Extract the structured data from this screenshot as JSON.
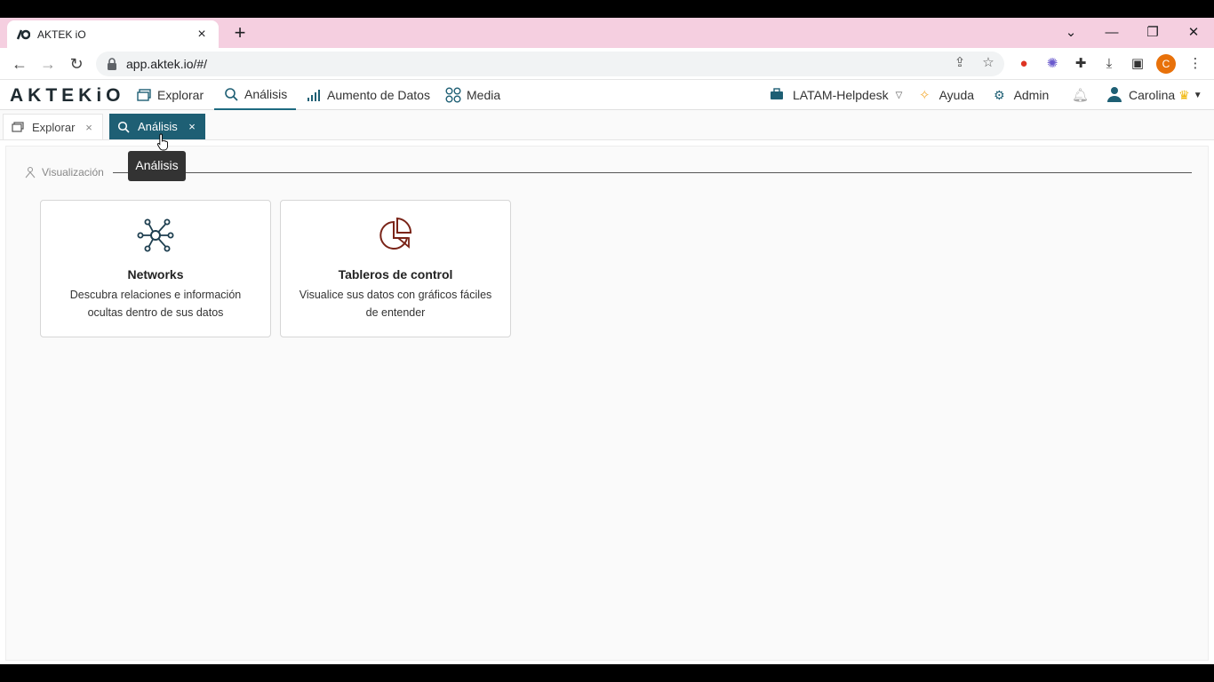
{
  "browser": {
    "tab_title": "AKTEK iO",
    "tab_close": "×",
    "new_tab": "+",
    "url": "app.aktek.io/#/",
    "profile_initial": "C",
    "window_controls": {
      "dropdown": "⌄",
      "minimize": "—",
      "restore": "❐",
      "close": "✕"
    }
  },
  "app": {
    "logo": "AKTEKiO",
    "nav": [
      {
        "label": "Explorar",
        "icon": "window-icon"
      },
      {
        "label": "Análisis",
        "icon": "search-analytics-icon",
        "active": true
      },
      {
        "label": "Aumento de Datos",
        "icon": "bar-chart-icon"
      },
      {
        "label": "Media",
        "icon": "grid-circles-icon"
      }
    ],
    "workspace": "LATAM-Helpdesk",
    "help": "Ayuda",
    "admin": "Admin",
    "user": "Carolina"
  },
  "workspace_tabs": [
    {
      "label": "Explorar",
      "close": "×"
    },
    {
      "label": "Análisis",
      "close": "×"
    }
  ],
  "tooltip": "Análisis",
  "section": {
    "label": "Visualización"
  },
  "cards": [
    {
      "title": "Networks",
      "desc": "Descubra relaciones e información ocultas dentro de sus datos",
      "icon": "network-icon"
    },
    {
      "title": "Tableros de control",
      "desc": "Visualice sus datos con gráficos fáciles de entender",
      "icon": "pie-chart-icon"
    }
  ],
  "colors": {
    "accent": "#1e5f74",
    "tabstrip": "#f5cfe0",
    "pie": "#7a2418"
  }
}
